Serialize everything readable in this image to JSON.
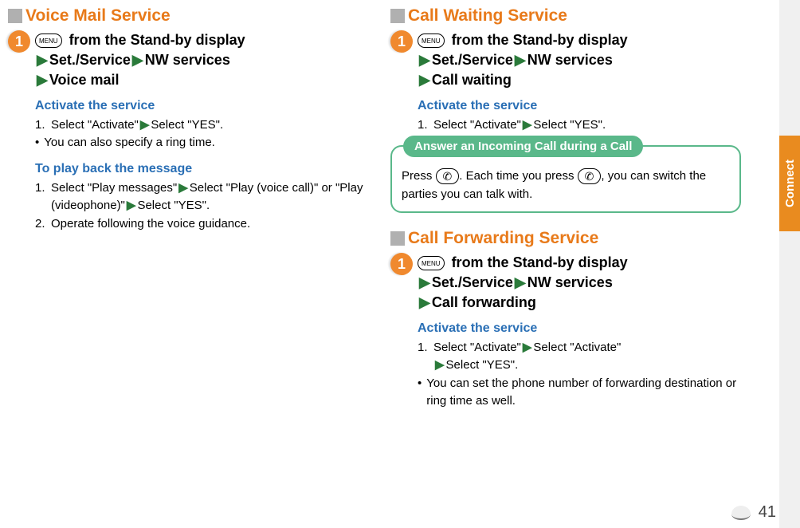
{
  "side_label": "Connect",
  "page_number": "41",
  "menu_label": "MENU",
  "left": {
    "voicemail": {
      "title": "Voice Mail Service",
      "step_num": "1",
      "line1_suffix": " from the Stand-by display",
      "line2a": "Set./Service",
      "line2b": "NW services",
      "line3": "Voice mail",
      "activate_title": "Activate the service",
      "activate_1n": "1.",
      "activate_1a": "Select \"Activate\"",
      "activate_1b": "Select \"YES\".",
      "activate_note_b": "•",
      "activate_note": "You can also specify a ring time.",
      "playback_title": "To play back the message",
      "play_1n": "1.",
      "play_1a": "Select \"Play messages\"",
      "play_1b": "Select \"Play (voice call)\" or \"Play (videophone)\"",
      "play_1c": "Select \"YES\".",
      "play_2n": "2.",
      "play_2": "Operate following the voice guidance."
    }
  },
  "right": {
    "callwaiting": {
      "title": "Call Waiting Service",
      "step_num": "1",
      "line1_suffix": " from the Stand-by display",
      "line2a": "Set./Service",
      "line2b": "NW services",
      "line3": "Call waiting",
      "activate_title": "Activate the service",
      "activate_1n": "1.",
      "activate_1a": "Select \"Activate\"",
      "activate_1b": "Select \"YES\".",
      "callout_tab": "Answer an Incoming Call during a Call",
      "callout_a": "Press ",
      "callout_b": ". Each time you press ",
      "callout_c": ", you can switch the parties you can talk with.",
      "call_icon": "✆"
    },
    "callforwarding": {
      "title": "Call Forwarding Service",
      "step_num": "1",
      "line1_suffix": " from the Stand-by display",
      "line2a": "Set./Service",
      "line2b": "NW services",
      "line3": "Call forwarding",
      "activate_title": "Activate the service",
      "activate_1n": "1.",
      "activate_1a": "Select \"Activate\"",
      "activate_1b": "Select \"Activate\"",
      "activate_1c": "Select \"YES\".",
      "activate_note_b": "•",
      "activate_note": "You can set the phone number of forwarding destination or ring time as well."
    }
  }
}
